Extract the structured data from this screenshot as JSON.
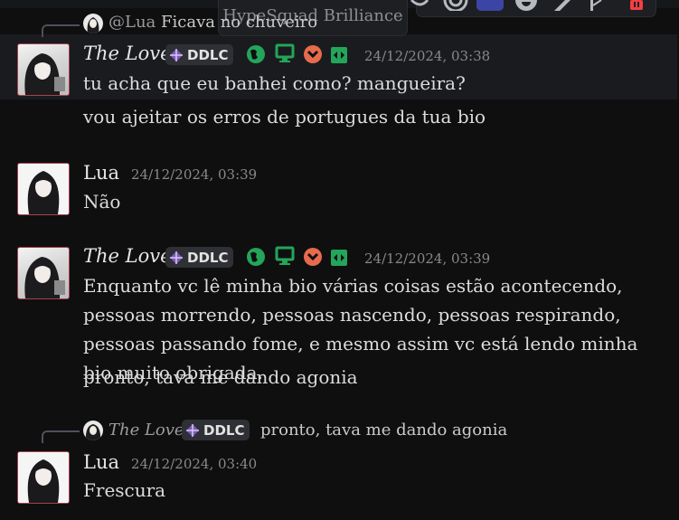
{
  "tooltip": {
    "text": "HypeSquad Brilliance"
  },
  "toolbar": {
    "icons": [
      "thumbs-up-icon",
      "refresh-icon",
      "thread-reply-icon",
      "expand-icon",
      "reply-icon",
      "mention-icon",
      "screen-icon",
      "emoji-icon",
      "edit-icon",
      "pin-icon",
      "delete-icon"
    ],
    "delete_color": "#f23f43"
  },
  "messages": [
    {
      "reply": {
        "author": "@Lua",
        "text": "Ficava no chuveiro"
      },
      "author": "The Love",
      "tag": "DDLC",
      "timestamp": "24/12/2024, 03:38",
      "lines": [
        "tu acha que eu banhei como? mangueira?",
        "vou ajeitar os erros de portugues da tua bio"
      ]
    },
    {
      "author": "Lua",
      "timestamp": "24/12/2024, 03:39",
      "lines": [
        "Não"
      ]
    },
    {
      "author": "The Love",
      "tag": "DDLC",
      "timestamp": "24/12/2024, 03:39",
      "paragraph": "Enquanto vc lê minha bio várias coisas estão acontecendo, pessoas morrendo, pessoas nascendo, pessoas respirando, pessoas passando fome, e mesmo assim vc está lendo minha bio muito obrigada.",
      "lines": [
        "pronto, tava me dando agonia"
      ]
    },
    {
      "reply": {
        "author": "The Love",
        "tag": "DDLC",
        "text": "pronto, tava me dando agonia"
      },
      "author": "Lua",
      "timestamp": "24/12/2024, 03:40",
      "lines": [
        "Frescura"
      ]
    }
  ],
  "badges": [
    "hypesquad-globe-icon",
    "desktop-icon",
    "chevron-badge-icon",
    "nitro-badge-icon"
  ],
  "colors": {
    "accent_green": "#23a55a",
    "badge_orange": "#e66b4d",
    "tag_bg": "#2f3035",
    "gem": "#a76cf0"
  }
}
